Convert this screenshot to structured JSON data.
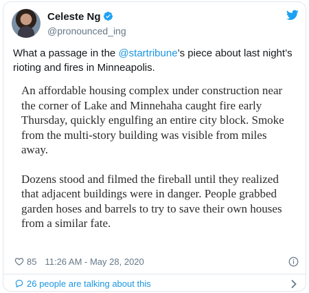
{
  "author": {
    "display_name": "Celeste Ng",
    "handle": "@pronounced_ing"
  },
  "tweet": {
    "text_before": "What a passage in the ",
    "mention": "@startribune",
    "text_after": "’s piece about last night’s rioting and fires in Minneapolis."
  },
  "quote": {
    "paragraphs": [
      "An affordable housing complex under construction near the corner of Lake and Minnehaha caught fire early Thursday, quickly engulfing an entire city block. Smoke from the multi-story building was visible from miles away.",
      "Dozens stood and filmed the fireball until they realized that adjacent buildings were in danger. People grabbed garden hoses and barrels to try to save their own houses from a similar fate."
    ]
  },
  "meta": {
    "likes": "85",
    "timestamp": "11:26 AM - May 28, 2020"
  },
  "footer": {
    "talking": "26 people are talking about this"
  },
  "colors": {
    "link": "#1b95e0",
    "secondary": "#657786",
    "border": "#e1e8ed"
  },
  "icons": [
    "verified-icon",
    "twitter-logo-icon",
    "heart-icon",
    "info-icon",
    "comment-icon",
    "chevron-right-icon"
  ]
}
